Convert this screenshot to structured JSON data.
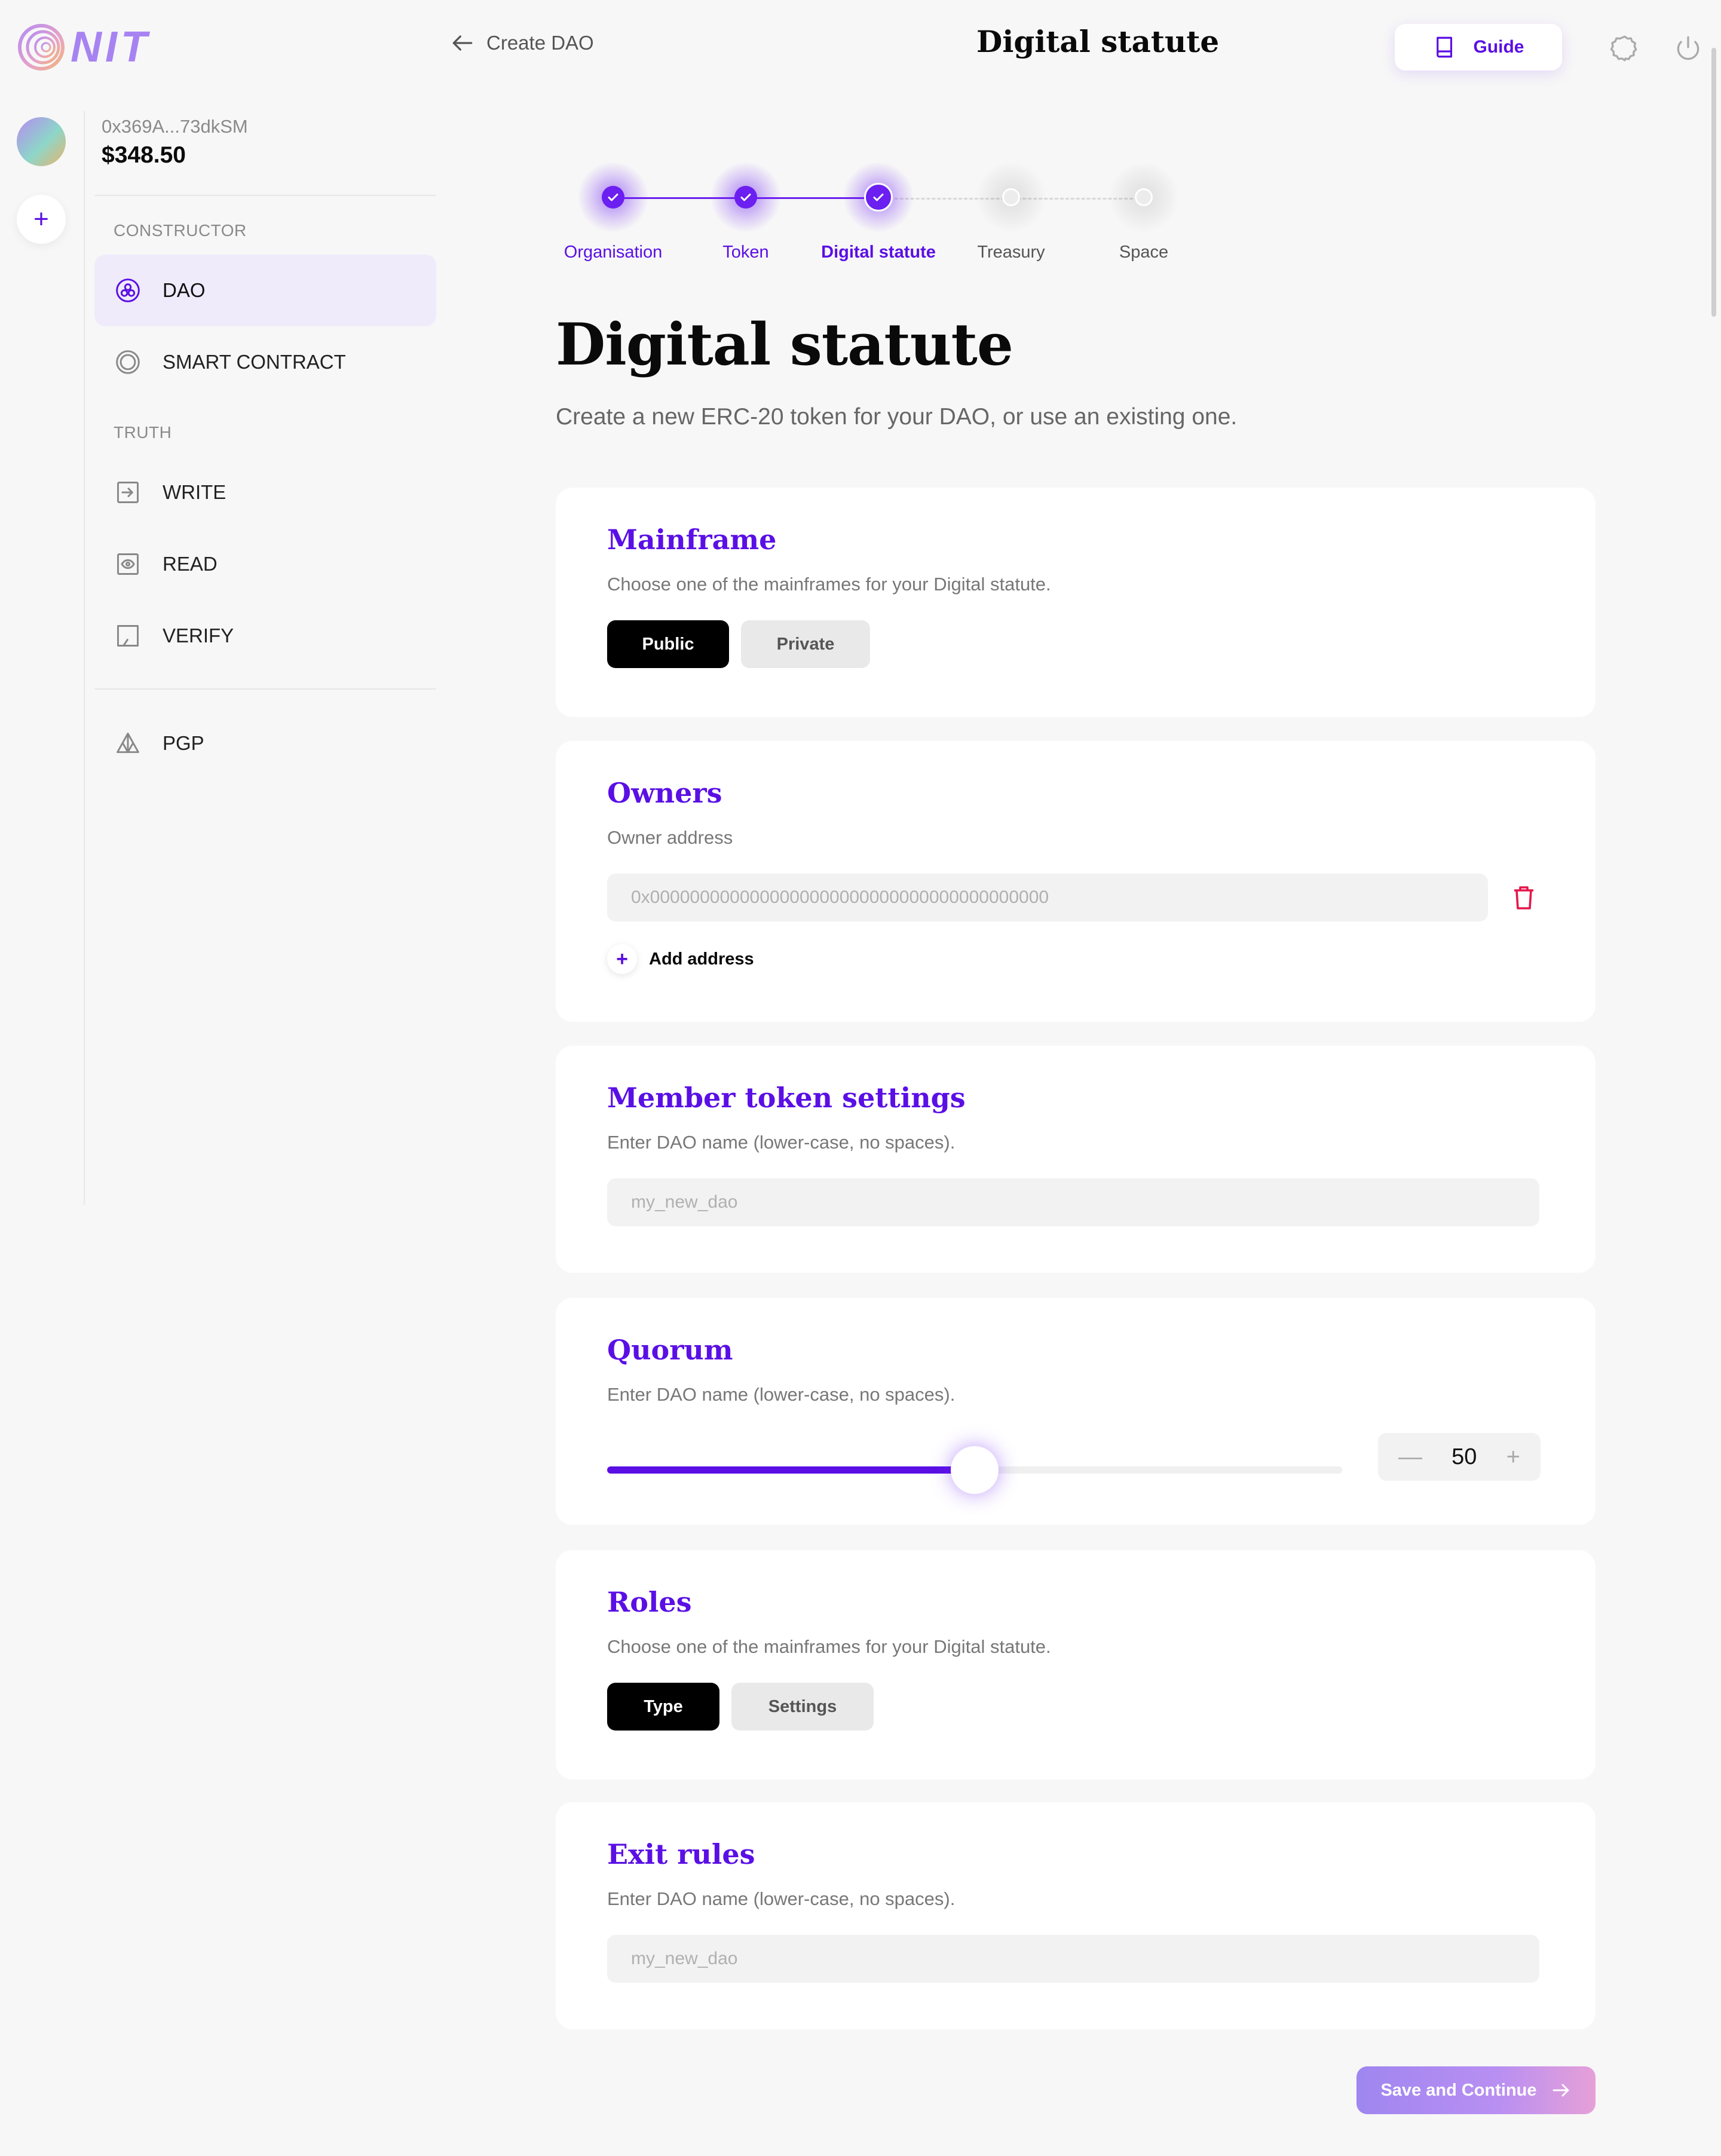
{
  "brand": {
    "name": "NIT"
  },
  "header": {
    "back_label": "Create DAO",
    "title": "Digital statute",
    "guide_label": "Guide"
  },
  "wallet": {
    "address": "0x369A...73dkSM",
    "balance": "$348.50"
  },
  "sidebar": {
    "sections": [
      {
        "label": "CONSTRUCTOR"
      },
      {
        "label": "TRUTH"
      }
    ],
    "items": [
      {
        "label": "DAO",
        "icon": "dao-icon",
        "active": true
      },
      {
        "label": "SMART CONTRACT",
        "icon": "smart-contract-icon"
      },
      {
        "label": "WRITE",
        "icon": "write-icon"
      },
      {
        "label": "READ",
        "icon": "read-icon"
      },
      {
        "label": "VERIFY",
        "icon": "verify-icon"
      },
      {
        "label": "PGP",
        "icon": "pgp-icon"
      }
    ]
  },
  "stepper": {
    "steps": [
      {
        "label": "Organisation",
        "state": "done"
      },
      {
        "label": "Token",
        "state": "done"
      },
      {
        "label": "Digital statute",
        "state": "current"
      },
      {
        "label": "Treasury",
        "state": "todo"
      },
      {
        "label": "Space",
        "state": "todo"
      }
    ]
  },
  "page": {
    "heading": "Digital statute",
    "subtitle": "Create a new ERC-20 token for your DAO, or use an existing one."
  },
  "cards": {
    "mainframe": {
      "title": "Mainframe",
      "desc": "Choose one of the mainframes for your Digital statute.",
      "options": [
        "Public",
        "Private"
      ],
      "selected": "Public"
    },
    "owners": {
      "title": "Owners",
      "desc": "Owner address",
      "address_placeholder": "0x0000000000000000000000000000000000000000",
      "add_label": "Add address"
    },
    "member_token": {
      "title": "Member token settings",
      "desc": "Enter DAO name (lower-case, no spaces).",
      "placeholder": "my_new_dao"
    },
    "quorum": {
      "title": "Quorum",
      "desc": "Enter DAO name (lower-case, no spaces).",
      "value": "50",
      "slider_fraction": 0.5
    },
    "roles": {
      "title": "Roles",
      "desc": "Choose one of the mainframes for your Digital statute.",
      "options": [
        "Type",
        "Settings"
      ],
      "selected": "Type"
    },
    "exit_rules": {
      "title": "Exit rules",
      "desc": "Enter DAO name (lower-case, no spaces).",
      "placeholder": "my_new_dao"
    }
  },
  "actions": {
    "save_label": "Save and Continue"
  },
  "colors": {
    "accent": "#5a0fe5",
    "danger": "#e5164a",
    "background": "#f7f7f7"
  }
}
